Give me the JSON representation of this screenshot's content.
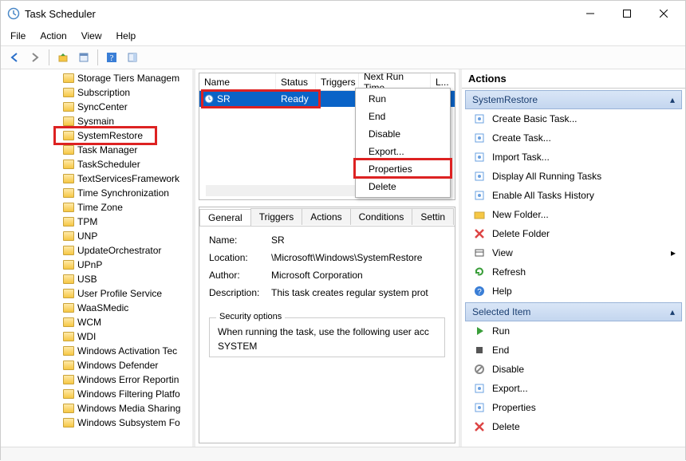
{
  "window": {
    "title": "Task Scheduler"
  },
  "menus": [
    "File",
    "Action",
    "View",
    "Help"
  ],
  "tree": {
    "items": [
      "Storage Tiers Managem",
      "Subscription",
      "SyncCenter",
      "Sysmain",
      "SystemRestore",
      "Task Manager",
      "TaskScheduler",
      "TextServicesFramework",
      "Time Synchronization",
      "Time Zone",
      "TPM",
      "UNP",
      "UpdateOrchestrator",
      "UPnP",
      "USB",
      "User Profile Service",
      "WaaSMedic",
      "WCM",
      "WDI",
      "Windows Activation Tec",
      "Windows Defender",
      "Windows Error Reportin",
      "Windows Filtering Platfo",
      "Windows Media Sharing",
      "Windows Subsystem Fo"
    ],
    "highlight_index": 4
  },
  "tasklist": {
    "columns": [
      "Name",
      "Status",
      "Triggers",
      "Next Run Time",
      "L..."
    ],
    "row": {
      "name": "SR",
      "status": "Ready"
    }
  },
  "context_menu": [
    "Run",
    "End",
    "Disable",
    "Export...",
    "Properties",
    "Delete"
  ],
  "context_highlight_index": 4,
  "detail": {
    "tabs": [
      "General",
      "Triggers",
      "Actions",
      "Conditions",
      "Settin"
    ],
    "active_tab": 0,
    "name_lbl": "Name:",
    "name_val": "SR",
    "location_lbl": "Location:",
    "location_val": "\\Microsoft\\Windows\\SystemRestore",
    "author_lbl": "Author:",
    "author_val": "Microsoft Corporation",
    "desc_lbl": "Description:",
    "desc_val": "This task creates regular system prot",
    "security_legend": "Security options",
    "security_line1": "When running the task, use the following user acc",
    "security_line2": "SYSTEM"
  },
  "actions": {
    "pane_title": "Actions",
    "section1": "SystemRestore",
    "items1": [
      "Create Basic Task...",
      "Create Task...",
      "Import Task...",
      "Display All Running Tasks",
      "Enable All Tasks History",
      "New Folder...",
      "Delete Folder",
      "View",
      "Refresh",
      "Help"
    ],
    "section2": "Selected Item",
    "items2": [
      "Run",
      "End",
      "Disable",
      "Export...",
      "Properties",
      "Delete"
    ]
  }
}
